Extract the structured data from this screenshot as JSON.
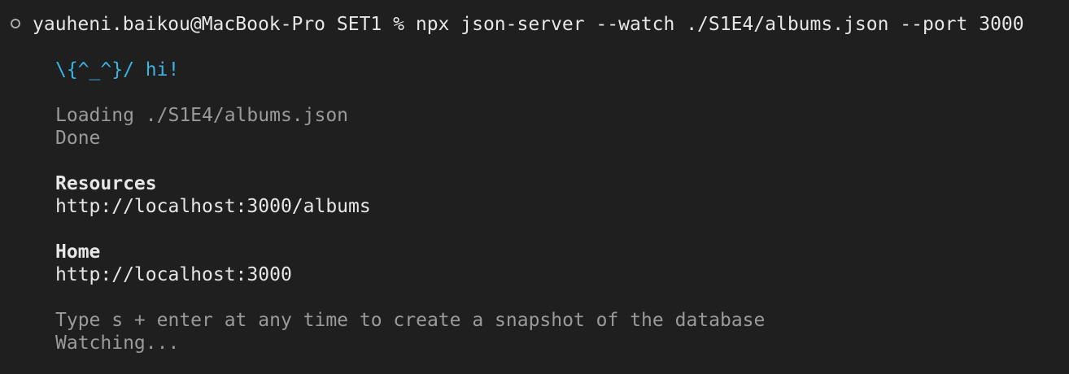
{
  "prompt": {
    "user_host": "yauheni.baikou@MacBook-Pro",
    "cwd": "SET1",
    "symbol": "%",
    "command": "npx json-server --watch ./S1E4/albums.json --port 3000",
    "status_icon": "circle-outline-icon"
  },
  "output": {
    "greeting": "\\{^_^}/ hi!",
    "loading": "Loading ./S1E4/albums.json",
    "done": "Done",
    "resources_heading": "Resources",
    "resources_url": "http://localhost:3000/albums",
    "home_heading": "Home",
    "home_url": "http://localhost:3000",
    "snapshot_hint": "Type s + enter at any time to create a snapshot of the database",
    "watching": "Watching..."
  },
  "colors": {
    "background": "#1f1f1f",
    "greeting": "#3ab4e3",
    "dim_text": "#9a9a9a",
    "bright_text": "#e6e6e6"
  }
}
